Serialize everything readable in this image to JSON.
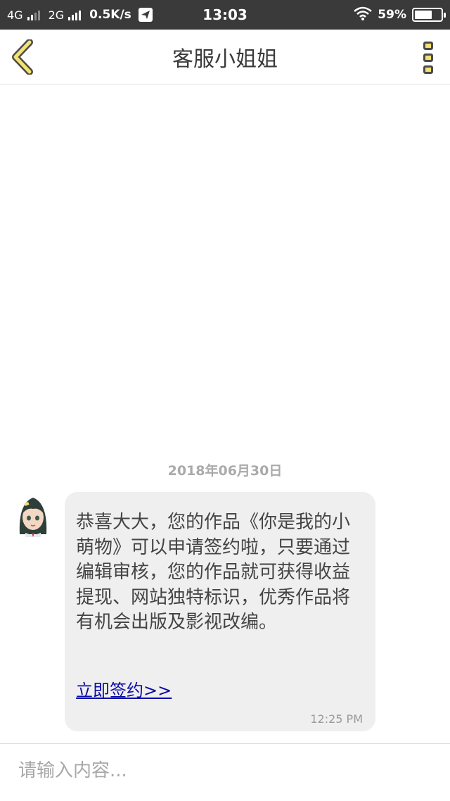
{
  "status_bar": {
    "network_1": "4G",
    "network_2": "2G",
    "speed": "0.5K/s",
    "time": "13:03",
    "battery": "59%"
  },
  "header": {
    "title": "客服小姐姐"
  },
  "chat": {
    "date": "2018年06月30日",
    "message": {
      "text": "恭喜大大，您的作品《你是我的小萌物》可以申请签约啦，只要通过编辑审核，您的作品就可获得收益提现、网站独特标识，优秀作品将有机会出版及影视改编。",
      "link": "立即签约>>",
      "time": "12:25 PM"
    }
  },
  "input": {
    "placeholder": "请输入内容..."
  },
  "colors": {
    "accent": "#f4e271",
    "status_bar_bg": "#3a3a3a",
    "link": "#0a0aa6"
  }
}
